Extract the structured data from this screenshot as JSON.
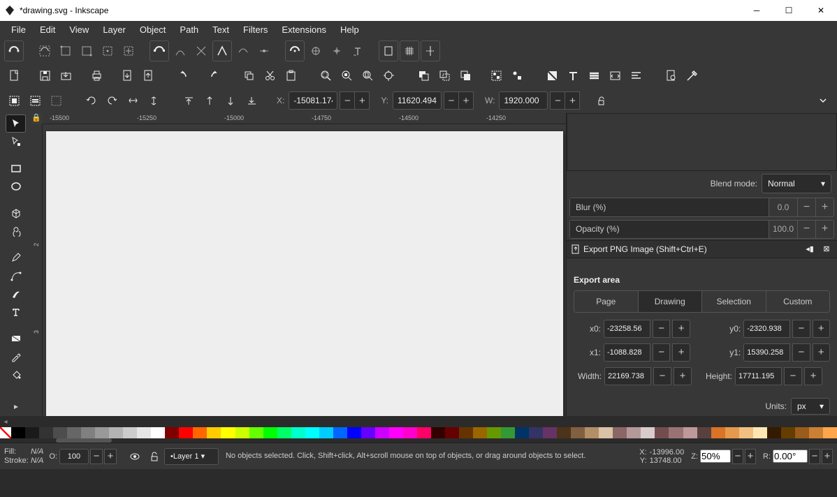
{
  "title": "*drawing.svg - Inkscape",
  "menus": [
    "File",
    "Edit",
    "View",
    "Layer",
    "Object",
    "Path",
    "Text",
    "Filters",
    "Extensions",
    "Help"
  ],
  "pos": {
    "x": "-15081.174",
    "y": "11620.494",
    "w": "1920.000"
  },
  "ruler_h": [
    "-15500",
    "-15250",
    "-15000",
    "-14750",
    "-14500",
    "-14250"
  ],
  "ruler_v": [
    "2",
    "3"
  ],
  "blend": {
    "label": "Blend mode:",
    "value": "Normal"
  },
  "blur": {
    "label": "Blur (%)",
    "value": "0.0"
  },
  "opacity": {
    "label": "Opacity (%)",
    "value": "100.0"
  },
  "export": {
    "title": "Export PNG Image (Shift+Ctrl+E)",
    "area_label": "Export area",
    "tabs": [
      "Page",
      "Drawing",
      "Selection",
      "Custom"
    ],
    "x0l": "x0:",
    "x0": "-23258.56",
    "y0l": "y0:",
    "y0": "-2320.938",
    "x1l": "x1:",
    "x1": "-1088.828",
    "y1l": "y1:",
    "y1": "15390.258",
    "wl": "Width:",
    "w": "22169.738",
    "hl": "Height:",
    "h": "17711.195",
    "units_l": "Units:",
    "units": "px"
  },
  "palette": [
    "#000000",
    "#1a1a1a",
    "#333333",
    "#4d4d4d",
    "#666666",
    "#808080",
    "#999999",
    "#b3b3b3",
    "#cccccc",
    "#e6e6e6",
    "#ffffff",
    "#800000",
    "#ff0000",
    "#ff6600",
    "#ffcc00",
    "#ffff00",
    "#ccff00",
    "#66ff00",
    "#00ff00",
    "#00ff66",
    "#00ffcc",
    "#00ffff",
    "#00ccff",
    "#0066ff",
    "#0000ff",
    "#6600ff",
    "#cc00ff",
    "#ff00ff",
    "#ff00cc",
    "#ff0066",
    "#330000",
    "#660000",
    "#663300",
    "#996600",
    "#669900",
    "#339933",
    "#003366",
    "#333366",
    "#663366",
    "#4d3319",
    "#806040",
    "#b38f66",
    "#d9c2a6",
    "#8c6666",
    "#b39999",
    "#d9cccc",
    "#734d4d",
    "#997373",
    "#bf9999",
    "#594040",
    "#d97326",
    "#e6994d",
    "#f2bf80",
    "#ffe6b3",
    "#331a00",
    "#663d00",
    "#995c1a",
    "#cc8033",
    "#ffa64d"
  ],
  "status": {
    "fill_l": "Fill:",
    "fill_v": "N/A",
    "stroke_l": "Stroke:",
    "stroke_v": "N/A",
    "o_l": "O:",
    "o_v": "100",
    "layer": "•Layer 1 ▾",
    "msg": "No objects selected. Click, Shift+click, Alt+scroll mouse on top of objects, or drag around objects to select.",
    "cxl": "X:",
    "cx": "-13996.00",
    "cyl": "Y:",
    "cy": "13748.00",
    "zl": "Z:",
    "zv": "50%",
    "rl": "R:",
    "rv": "0.00°"
  }
}
